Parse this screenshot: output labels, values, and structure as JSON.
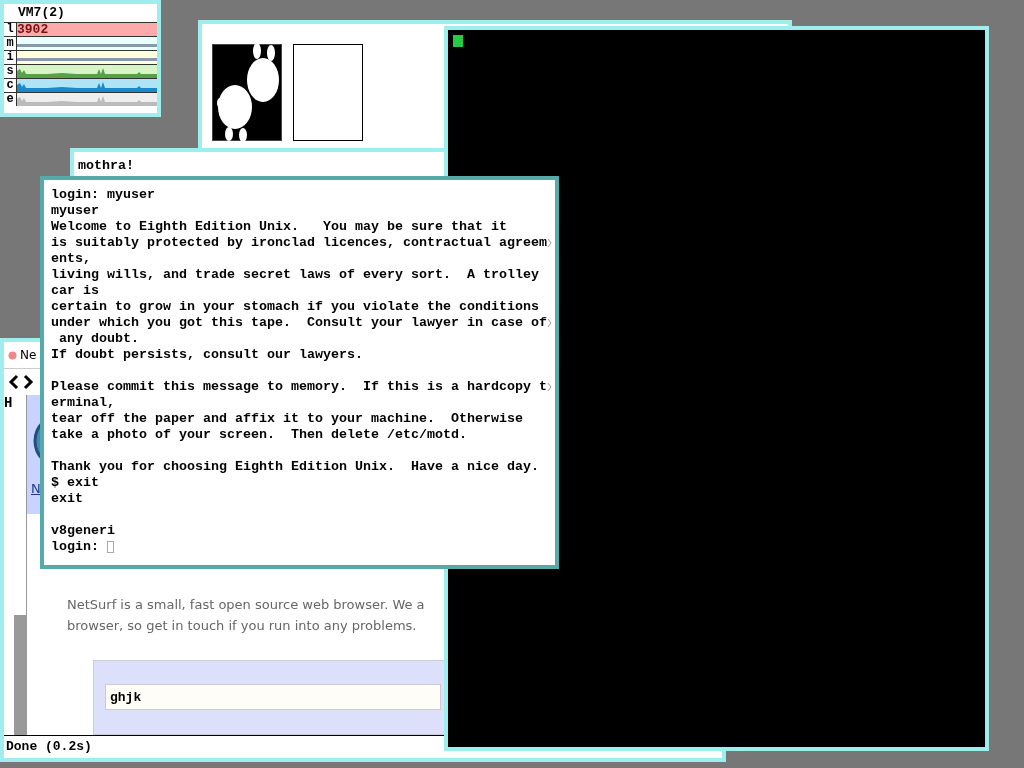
{
  "stats_window": {
    "title": "VM7(2)",
    "active": false,
    "rows": [
      {
        "label": "l",
        "color": "#ffaaaa",
        "value": "3902",
        "kind": "number"
      },
      {
        "label": "m",
        "color": "#eaffff",
        "kind": "line"
      },
      {
        "label": "i",
        "color": "#ffffe0",
        "kind": "line"
      },
      {
        "label": "s",
        "color": "#d8f5c8",
        "kind": "graph"
      },
      {
        "label": "c",
        "color": "#aee4f5",
        "kind": "graph"
      },
      {
        "label": "e",
        "color": "#eeeeee",
        "kind": "graph"
      }
    ]
  },
  "image_window": {
    "active": false,
    "frames": [
      {
        "kind": "picture"
      },
      {
        "kind": "empty"
      }
    ]
  },
  "mothra_window": {
    "active": false,
    "text": "mothra!"
  },
  "browser_window": {
    "active": false,
    "tab": {
      "label": "Ne",
      "selected": true
    },
    "url_fragment": "H",
    "link": "N",
    "paragraph": [
      "NetSurf is a small, fast open source web browser. We a",
      "browser, so get in touch if you run into any problems."
    ],
    "search": {
      "value": "ghjk"
    },
    "status": "Done (0.2s)"
  },
  "black_window": {
    "active": false,
    "cursor": true
  },
  "terminal_window": {
    "active": true,
    "lines": [
      {
        "text": "login: myuser",
        "wrapped": false
      },
      {
        "text": "myuser",
        "wrapped": false
      },
      {
        "text": "Welcome to Eighth Edition Unix.   You may be sure that it",
        "wrapped": false
      },
      {
        "text": "is suitably protected by ironclad licences, contractual agreem",
        "wrapped": true
      },
      {
        "text": "ents,",
        "wrapped": false
      },
      {
        "text": "living wills, and trade secret laws of every sort.  A trolley",
        "wrapped": false
      },
      {
        "text": "car is",
        "wrapped": false
      },
      {
        "text": "certain to grow in your stomach if you violate the conditions",
        "wrapped": false
      },
      {
        "text": "under which you got this tape.  Consult your lawyer in case of",
        "wrapped": true
      },
      {
        "text": " any doubt.",
        "wrapped": false
      },
      {
        "text": "If doubt persists, consult our lawyers.",
        "wrapped": false
      },
      {
        "wrapped": false
      },
      {
        "text": "Please commit this message to memory.  If this is a hardcopy t",
        "wrapped": true
      },
      {
        "text": "erminal,",
        "wrapped": false
      },
      {
        "text": "tear off the paper and affix it to your machine.  Otherwise",
        "wrapped": false
      },
      {
        "text": "take a photo of your screen.  Then delete /etc/motd.",
        "wrapped": false
      },
      {
        "wrapped": false
      },
      {
        "text": "Thank you for choosing Eighth Edition Unix.  Have a nice day.",
        "wrapped": false
      },
      {
        "text": "$ exit",
        "wrapped": false
      },
      {
        "text": "exit",
        "wrapped": false
      },
      {
        "wrapped": false
      },
      {
        "text": "v8generi",
        "wrapped": false
      },
      {
        "text": "login: ",
        "wrapped": false,
        "cursor": true
      }
    ]
  }
}
